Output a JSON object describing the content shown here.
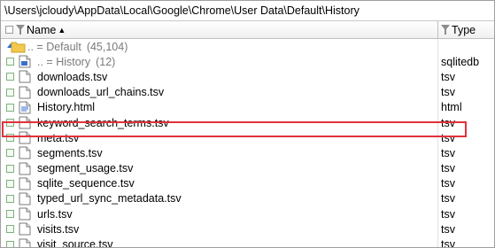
{
  "path_bar": {
    "path": "\\Users\\jcloudy\\AppData\\Local\\Google\\Chrome\\User Data\\Default\\History"
  },
  "columns": {
    "name": "Name",
    "type": "Type"
  },
  "up_rows": [
    {
      "name": "..  =  Default",
      "count": "(45,104)",
      "type": "",
      "icon": "folder-up-icon"
    },
    {
      "name": "..  =  History",
      "count": "(12)",
      "type": "sqlitedb",
      "icon": "db-file-up-icon"
    }
  ],
  "files": [
    {
      "name": "downloads.tsv",
      "type": "tsv"
    },
    {
      "name": "downloads_url_chains.tsv",
      "type": "tsv"
    },
    {
      "name": "History.html",
      "type": "html"
    },
    {
      "name": "keyword_search_terms.tsv",
      "type": "tsv"
    },
    {
      "name": "meta.tsv",
      "type": "tsv"
    },
    {
      "name": "segments.tsv",
      "type": "tsv"
    },
    {
      "name": "segment_usage.tsv",
      "type": "tsv"
    },
    {
      "name": "sqlite_sequence.tsv",
      "type": "tsv"
    },
    {
      "name": "typed_url_sync_metadata.tsv",
      "type": "tsv"
    },
    {
      "name": "urls.tsv",
      "type": "tsv"
    },
    {
      "name": "visits.tsv",
      "type": "tsv"
    },
    {
      "name": "visit_source.tsv",
      "type": "tsv"
    }
  ],
  "highlighted_file": "History.html",
  "colors": {
    "highlight_border": "#e1323a",
    "checkbox_green": "#7fb07f"
  },
  "sort": {
    "column": "Name",
    "direction": "ascending"
  }
}
